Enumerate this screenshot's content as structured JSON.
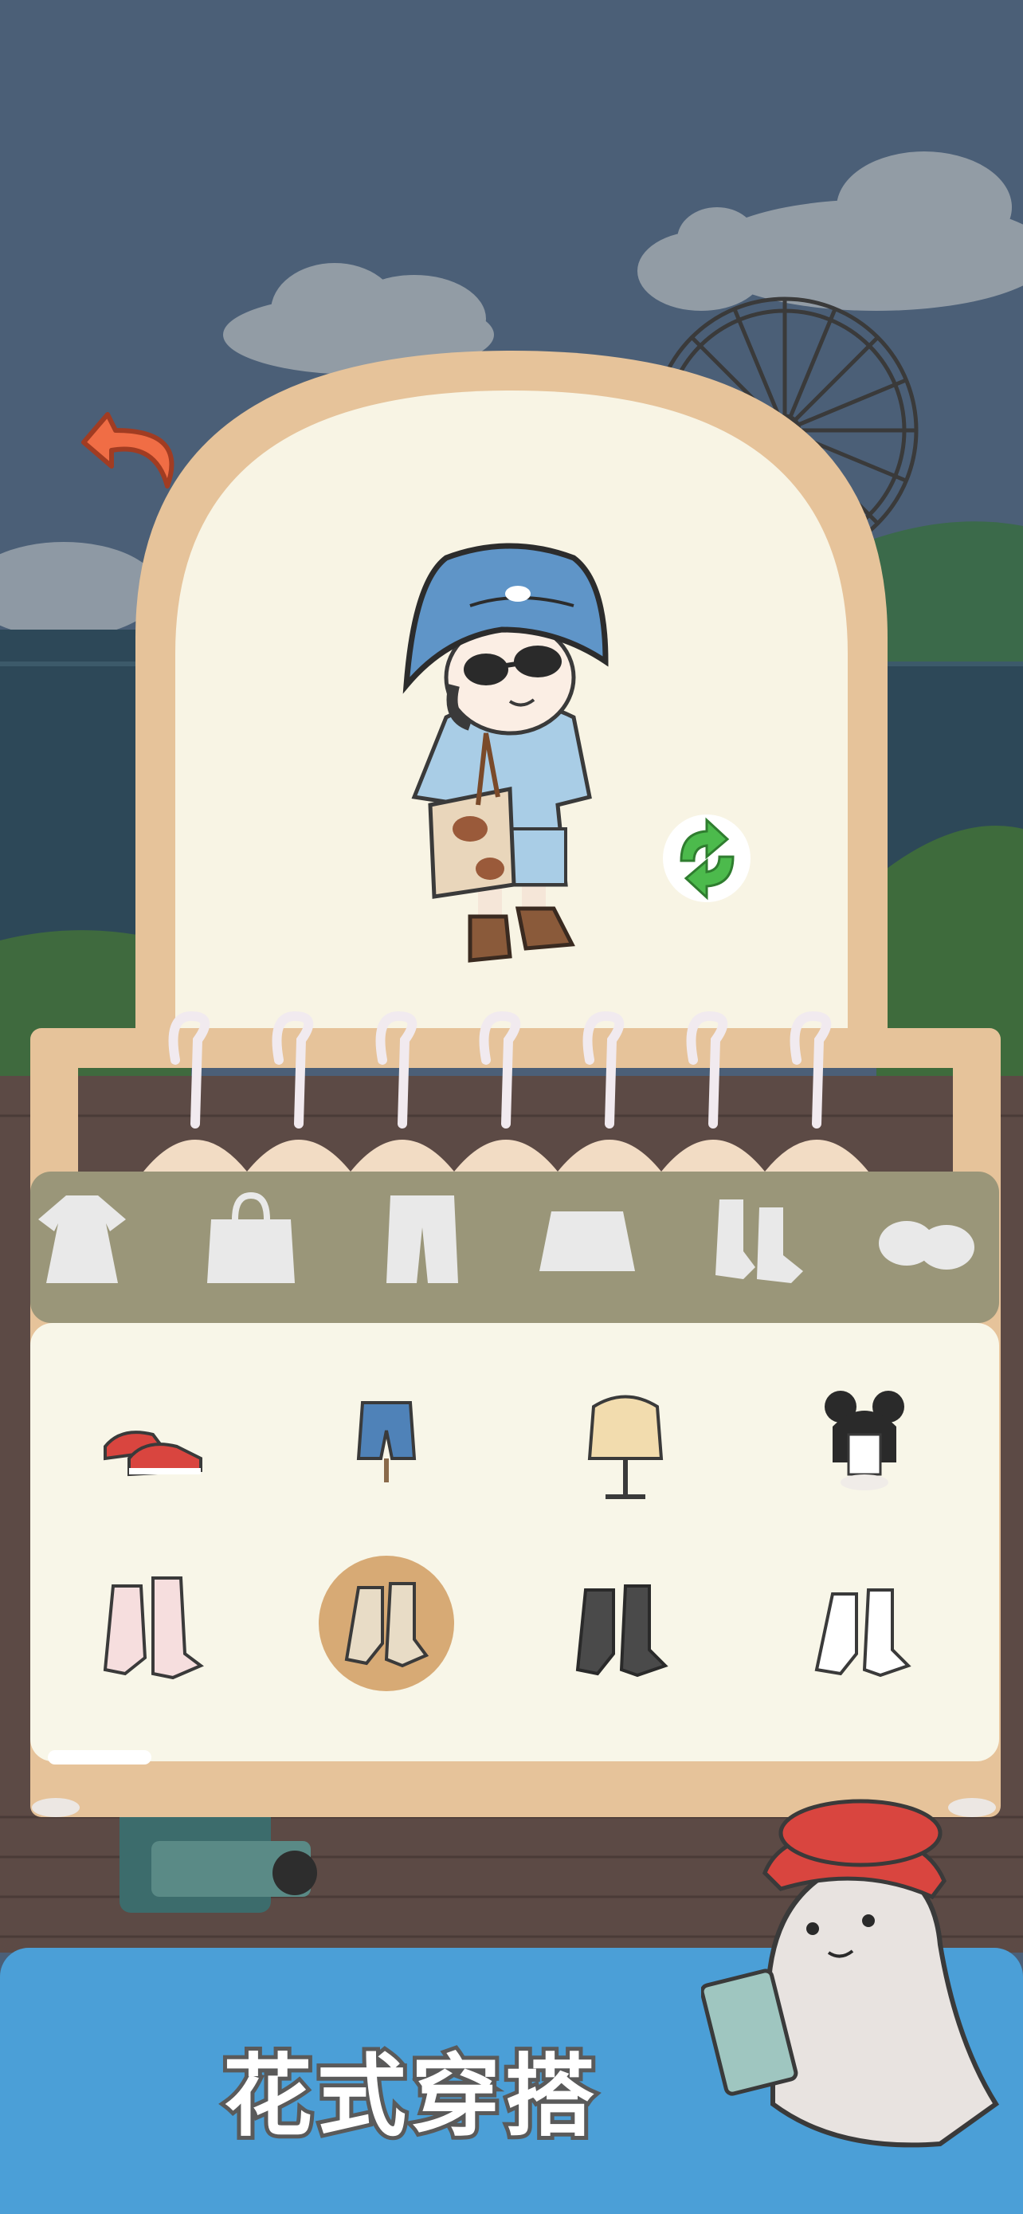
{
  "colors": {
    "sky": "#4b5f77",
    "sea": "#2e4a5c",
    "wardrobe_frame": "#e6c39a",
    "wardrobe_inner": "#f8f4e4",
    "tab_bar": "#9a9679",
    "tab_icon": "#e9e9e9",
    "panel": "#f8f6e8",
    "selected_slot": "#d7aa75",
    "refresh_green": "#4cba4c",
    "back_arrow": "#f06d45",
    "banner": "#4b9fd7"
  },
  "back_button": {
    "icon": "back-arrow-icon"
  },
  "refresh_button": {
    "icon": "refresh-icon"
  },
  "category_tabs": [
    {
      "icon": "dress-icon"
    },
    {
      "icon": "bag-icon"
    },
    {
      "icon": "pants-icon"
    },
    {
      "icon": "skirt-icon"
    },
    {
      "icon": "socks-icon"
    },
    {
      "icon": "shoes-icon"
    }
  ],
  "items": [
    {
      "icon": "red-sneakers-icon",
      "selected": false
    },
    {
      "icon": "denim-shorts-icon",
      "selected": false
    },
    {
      "icon": "hoodie-mannequin-icon",
      "selected": false
    },
    {
      "icon": "bun-hairstyle-icon",
      "selected": false
    },
    {
      "icon": "striped-socks-icon",
      "selected": false
    },
    {
      "icon": "beige-socks-icon",
      "selected": true
    },
    {
      "icon": "black-socks-icon",
      "selected": false
    },
    {
      "icon": "white-ruffle-socks-icon",
      "selected": false
    }
  ],
  "banner": {
    "title": "花式穿搭"
  }
}
